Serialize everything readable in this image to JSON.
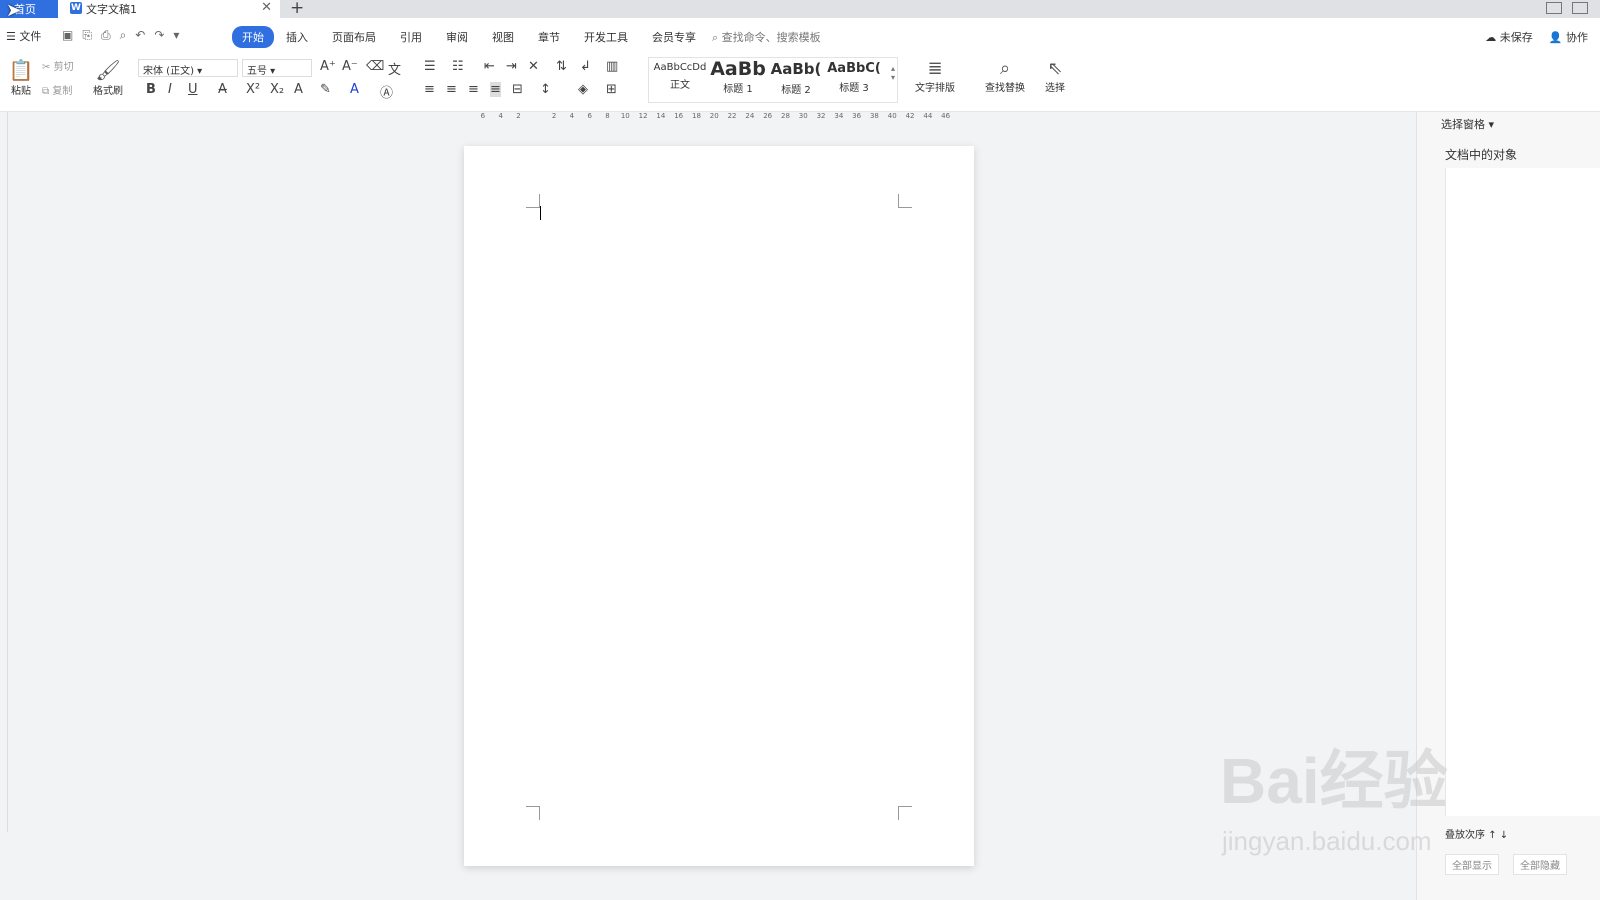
{
  "tabs": {
    "home": "首页",
    "doc": "文字文稿1"
  },
  "menu": {
    "file": "文件",
    "tabs": [
      "开始",
      "插入",
      "页面布局",
      "引用",
      "审阅",
      "视图",
      "章节",
      "开发工具",
      "会员专享"
    ],
    "search": "查找命令、搜索模板",
    "unsaved": "未保存",
    "collab": "协作"
  },
  "ribbon": {
    "paste": "粘贴",
    "cut": "剪切",
    "copy": "复制",
    "format_painter": "格式刷",
    "font": "宋体 (正文)",
    "size": "五号",
    "style_samples": [
      "AaBbCcDd",
      "AaBb",
      "AaBb(",
      "AaBbC("
    ],
    "style_labels": [
      "正文",
      "标题 1",
      "标题 2",
      "标题 3"
    ],
    "text_layout": "文字排版",
    "find_replace": "查找替换",
    "select": "选择"
  },
  "ruler": [
    "6",
    "4",
    "2",
    "",
    "2",
    "4",
    "6",
    "8",
    "10",
    "12",
    "14",
    "16",
    "18",
    "20",
    "22",
    "24",
    "26",
    "28",
    "30",
    "32",
    "34",
    "36",
    "38",
    "40",
    "42",
    "44",
    "46"
  ],
  "panel": {
    "title": "选择窗格",
    "objects": "文档中的对象",
    "order": "叠放次序",
    "show_all": "全部显示",
    "hide_all": "全部隐藏"
  },
  "watermark": {
    "brand": "Bai经验",
    "url": "jingyan.baidu.com"
  }
}
